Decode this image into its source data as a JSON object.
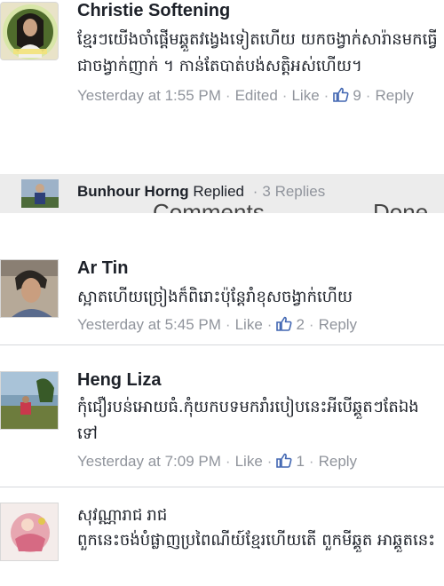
{
  "comments": [
    {
      "author": "Christie Softening",
      "text": "ខ្មែរៗយើងចាំផ្តើមឆ្គួតវង្វេងទៀតហើយ យកចង្វាក់សារ៉ានមកធ្វើជាចង្វាក់ញាក់ ។ កាន់តែបាត់បង់សត្តិអស់ហើយ។",
      "time": "Yesterday at 1:55 PM",
      "edited": "Edited",
      "like": "Like",
      "like_count": "9",
      "reply": "Reply",
      "avatar_icon": "avatar-photo-woman"
    },
    {
      "author": "Ar Tin",
      "text": "ស្អាតហើយច្រៀងក៏ពិរោះប៉ុន្តែរាំខុសចង្វាក់ហើយ",
      "time": "Yesterday at 5:45 PM",
      "like": "Like",
      "like_count": "2",
      "reply": "Reply",
      "avatar_icon": "avatar-photo-man"
    },
    {
      "author": "Heng Liza",
      "text": "កុំជឿរបន់អោយធំ.កុំយកបទមករាំរបៀបនេះអីបើឆ្គួតៗតែឯងទៅ",
      "time": "Yesterday at 7:09 PM",
      "like": "Like",
      "like_count": "1",
      "reply": "Reply",
      "avatar_icon": "avatar-photo-landscape"
    },
    {
      "author": "សុវណ្ណារាជ រាជ",
      "text": "ពួកនេះចង់បំផ្លាញប្រពៃណីយ៍ខ្មែរហើយតើ ពួកមីឆ្គួត អាឆ្គួតនេះ",
      "avatar_icon": "avatar-photo-figurine"
    }
  ],
  "reply_summary": {
    "author": "Bunhour Horng",
    "action": "Replied",
    "count": "3 Replies"
  },
  "overlay": {
    "left": "Comments",
    "right": "Done"
  },
  "colors": {
    "text": "#1d2129",
    "meta": "#90949c",
    "link": "#4267b2",
    "divider": "#d6d8dc"
  }
}
